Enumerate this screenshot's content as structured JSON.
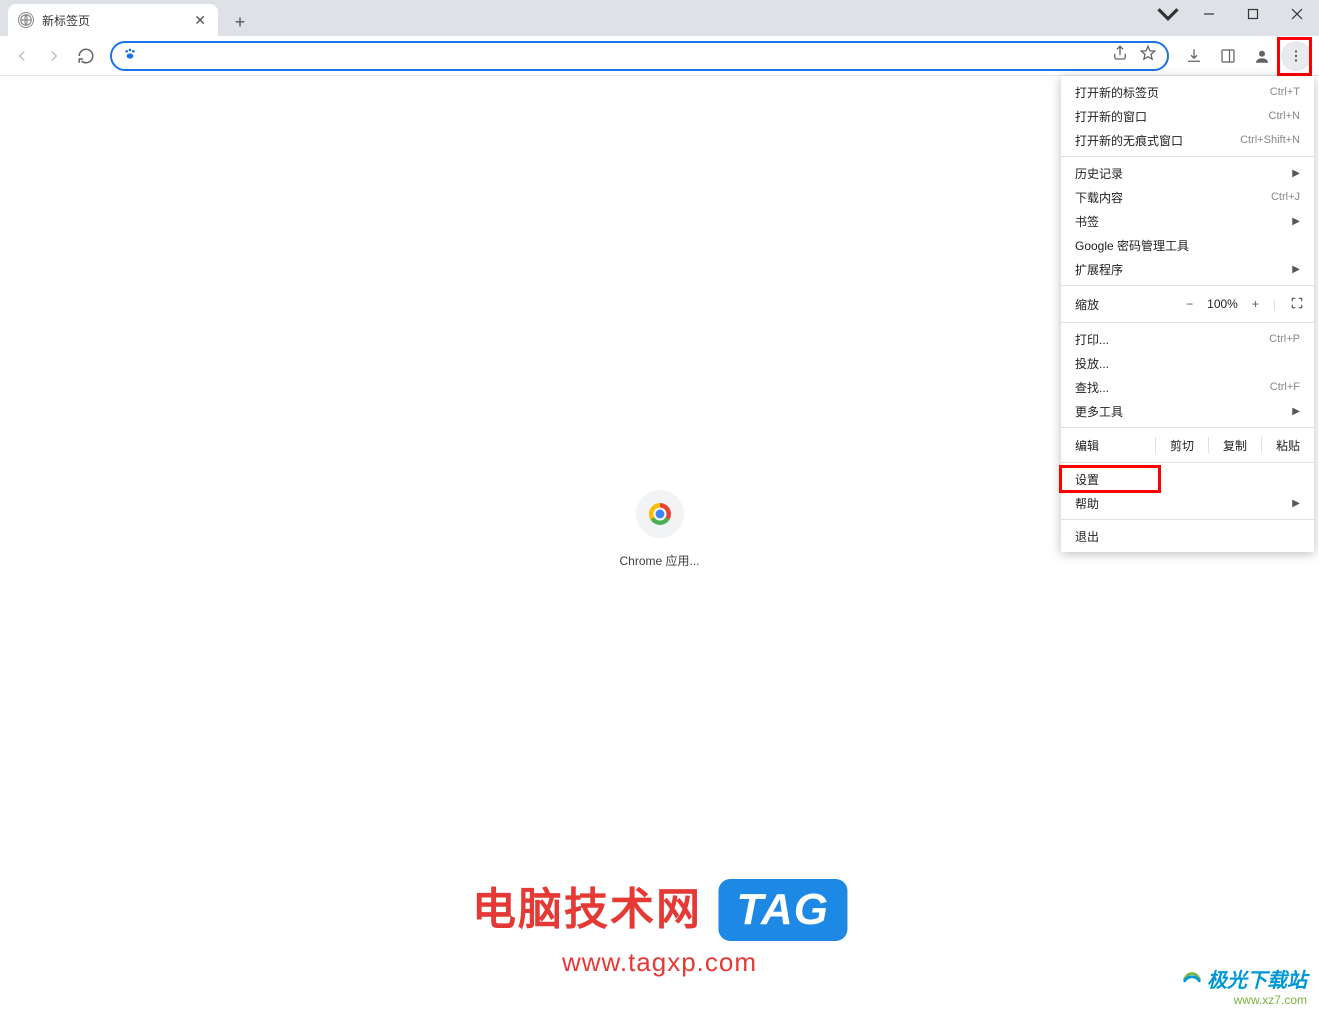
{
  "title_bar": {
    "tab_title": "新标签页"
  },
  "toolbar": {},
  "content": {
    "shortcut_label": "Chrome 应用..."
  },
  "menu": {
    "new_tab": {
      "label": "打开新的标签页",
      "shortcut": "Ctrl+T"
    },
    "new_window": {
      "label": "打开新的窗口",
      "shortcut": "Ctrl+N"
    },
    "new_incognito": {
      "label": "打开新的无痕式窗口",
      "shortcut": "Ctrl+Shift+N"
    },
    "history": {
      "label": "历史记录"
    },
    "downloads": {
      "label": "下载内容",
      "shortcut": "Ctrl+J"
    },
    "bookmarks": {
      "label": "书签"
    },
    "password_manager": {
      "label": "Google 密码管理工具"
    },
    "extensions": {
      "label": "扩展程序"
    },
    "zoom": {
      "label": "缩放",
      "minus": "−",
      "percent": "100%",
      "plus": "+"
    },
    "print": {
      "label": "打印...",
      "shortcut": "Ctrl+P"
    },
    "cast": {
      "label": "投放..."
    },
    "find": {
      "label": "查找...",
      "shortcut": "Ctrl+F"
    },
    "more_tools": {
      "label": "更多工具"
    },
    "edit": {
      "label": "编辑",
      "cut": "剪切",
      "copy": "复制",
      "paste": "粘贴"
    },
    "settings": {
      "label": "设置"
    },
    "help": {
      "label": "帮助"
    },
    "exit": {
      "label": "退出"
    }
  },
  "watermark": {
    "line1": "电脑技术网",
    "tag": "TAG",
    "line2": "www.tagxp.com",
    "corner1": "极光下载站",
    "corner2": "www.xz7.com"
  }
}
